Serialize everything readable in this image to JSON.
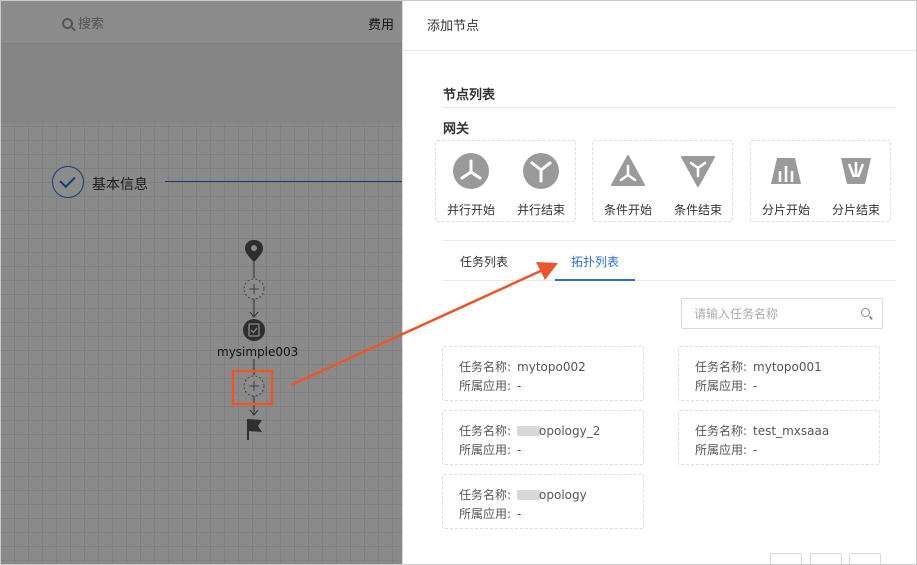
{
  "background": {
    "search_placeholder": "搜索",
    "fee_label": "费用",
    "step": {
      "label": "基本信息"
    },
    "flow_node_label": "mysimple003"
  },
  "panel": {
    "title": "添加节点",
    "section_title": "节点列表",
    "gateway_title": "网关",
    "gateway_groups": [
      {
        "nodes": [
          {
            "icon": "parallel-start-icon",
            "label": "并行开始"
          },
          {
            "icon": "parallel-end-icon",
            "label": "并行结束"
          }
        ]
      },
      {
        "nodes": [
          {
            "icon": "condition-start-icon",
            "label": "条件开始"
          },
          {
            "icon": "condition-end-icon",
            "label": "条件结束"
          }
        ]
      },
      {
        "nodes": [
          {
            "icon": "shard-start-icon",
            "label": "分片开始"
          },
          {
            "icon": "shard-end-icon",
            "label": "分片结束"
          }
        ]
      }
    ],
    "tabs": [
      {
        "label": "任务列表",
        "active": false
      },
      {
        "label": "拓扑列表",
        "active": true
      }
    ],
    "search": {
      "placeholder": "请输入任务名称"
    },
    "task_key": "任务名称:",
    "app_key": "所属应用:",
    "cards": [
      {
        "name": "mytopo002",
        "app": "-"
      },
      {
        "name": "mytopo001",
        "app": "-"
      },
      {
        "name": "opology_2",
        "app": "-"
      },
      {
        "name": "test_mxsaaa",
        "app": "-"
      },
      {
        "name": "opology",
        "app": "-"
      }
    ]
  },
  "colors": {
    "accent": "#2d6cd0",
    "annotation": "#e8572b",
    "icon_gray": "#9a9a9a"
  }
}
